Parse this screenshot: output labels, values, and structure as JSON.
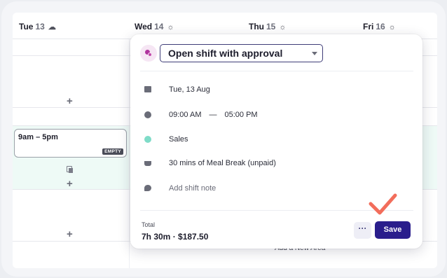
{
  "calendar": {
    "days": [
      {
        "label": "Tue",
        "date": "13",
        "weather": "cloud-icon"
      },
      {
        "label": "Wed",
        "date": "14",
        "weather": "sun-icon"
      },
      {
        "label": "Thu",
        "date": "15",
        "weather": "sun-icon"
      },
      {
        "label": "Fri",
        "date": "16",
        "weather": "sun-icon"
      }
    ],
    "add_symbol": "+",
    "shift": {
      "time": "9am – 5pm",
      "badge": "EMPTY"
    },
    "add_area": "Add a New Area"
  },
  "popup": {
    "shift_type": "Open shift with approval",
    "date": "Tue, 13 Aug",
    "start_time": "09:00 AM",
    "time_separator": "—",
    "end_time": "05:00 PM",
    "area": "Sales",
    "area_color": "#7fdcc8",
    "break": "30 mins of Meal Break (unpaid)",
    "note_placeholder": "Add shift note",
    "total_label": "Total",
    "total_value": "7h 30m · $187.50",
    "more_label": "···",
    "save_label": "Save"
  },
  "colors": {
    "accent": "#2a1e8c",
    "annotation": "#f26d5b"
  }
}
